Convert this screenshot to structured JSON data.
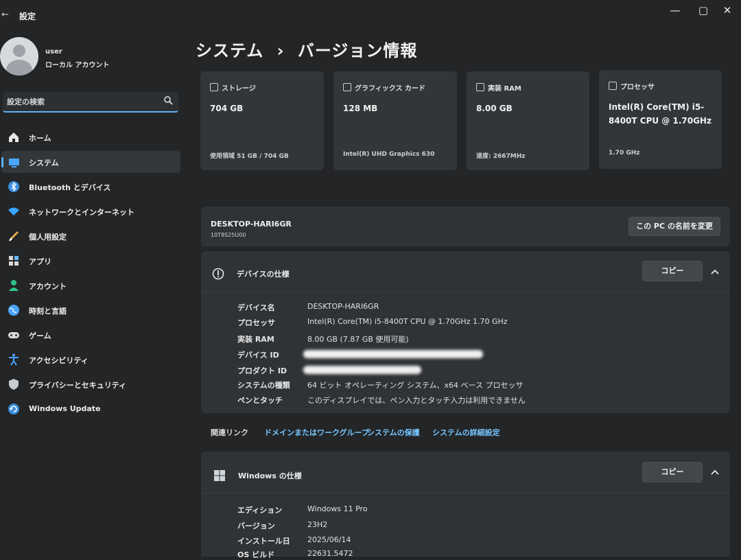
{
  "window": {
    "title": "設定",
    "back_glyph": "←",
    "minimize": "—",
    "maximize": "▢",
    "close": "✕"
  },
  "user": {
    "name": "user",
    "account_type": "ローカル アカウント"
  },
  "search": {
    "placeholder": "設定の検索"
  },
  "nav": [
    {
      "label": "ホーム",
      "icon": "home-icon"
    },
    {
      "label": "システム",
      "icon": "system-icon",
      "active": true
    },
    {
      "label": "Bluetooth とデバイス",
      "icon": "bluetooth-icon"
    },
    {
      "label": "ネットワークとインターネット",
      "icon": "wifi-icon"
    },
    {
      "label": "個人用設定",
      "icon": "brush-icon"
    },
    {
      "label": "アプリ",
      "icon": "apps-icon"
    },
    {
      "label": "アカウント",
      "icon": "account-icon"
    },
    {
      "label": "時刻と言語",
      "icon": "globe-icon"
    },
    {
      "label": "ゲーム",
      "icon": "gamepad-icon"
    },
    {
      "label": "アクセシビリティ",
      "icon": "accessibility-icon"
    },
    {
      "label": "プライバシーとセキュリティ",
      "icon": "shield-icon"
    },
    {
      "label": "Windows Update",
      "icon": "update-icon"
    }
  ],
  "breadcrumb": {
    "parent": "システム",
    "separator": "›",
    "current": "バージョン情報"
  },
  "cards": [
    {
      "title": "ストレージ",
      "value": "704 GB",
      "sub": "使用領域 51 GB / 704 GB"
    },
    {
      "title": "グラフィックス カード",
      "value": "128 MB",
      "sub": "Intel(R) UHD Graphics 630"
    },
    {
      "title": "実装 RAM",
      "value": "8.00 GB",
      "sub": "速度: 2667MHz"
    },
    {
      "title": "プロセッサ",
      "value": "Intel(R) Core(TM) i5-8400T CPU @ 1.70GHz",
      "sub": "1.70 GHz"
    }
  ],
  "device_header": {
    "name": "DESKTOP-HARI6GR",
    "model": "10T8S25U00",
    "rename_button": "この PC の名前を変更"
  },
  "device_specs": {
    "title": "デバイスの仕様",
    "copy_button": "コピー",
    "rows": [
      {
        "key": "デバイス名",
        "value": "DESKTOP-HARI6GR"
      },
      {
        "key": "プロセッサ",
        "value": "Intel(R) Core(TM) i5-8400T CPU @ 1.70GHz   1.70 GHz"
      },
      {
        "key": "実装 RAM",
        "value": "8.00 GB (7.87 GB 使用可能)"
      },
      {
        "key": "デバイス ID",
        "value": ""
      },
      {
        "key": "プロダクト ID",
        "value": ""
      },
      {
        "key": "システムの種類",
        "value": "64 ビット オペレーティング システム、x64 ベース プロセッサ"
      },
      {
        "key": "ペンとタッチ",
        "value": "このディスプレイでは、ペン入力とタッチ入力は利用できません"
      }
    ]
  },
  "related_links": {
    "label": "関連リンク",
    "links": [
      "ドメインまたはワークグループ",
      "システムの保護",
      "システムの詳細設定"
    ]
  },
  "windows_specs": {
    "title": "Windows の仕様",
    "copy_button": "コピー",
    "rows": [
      {
        "key": "エディション",
        "value": "Windows 11 Pro"
      },
      {
        "key": "バージョン",
        "value": "23H2"
      },
      {
        "key": "インストール日",
        "value": "2025/06/14"
      },
      {
        "key": "OS ビルド",
        "value": "22631.5472"
      }
    ]
  },
  "colors": {
    "accent": "#5fb2ff",
    "link": "#78c6ff",
    "background": "#232527",
    "card": "#333639"
  }
}
